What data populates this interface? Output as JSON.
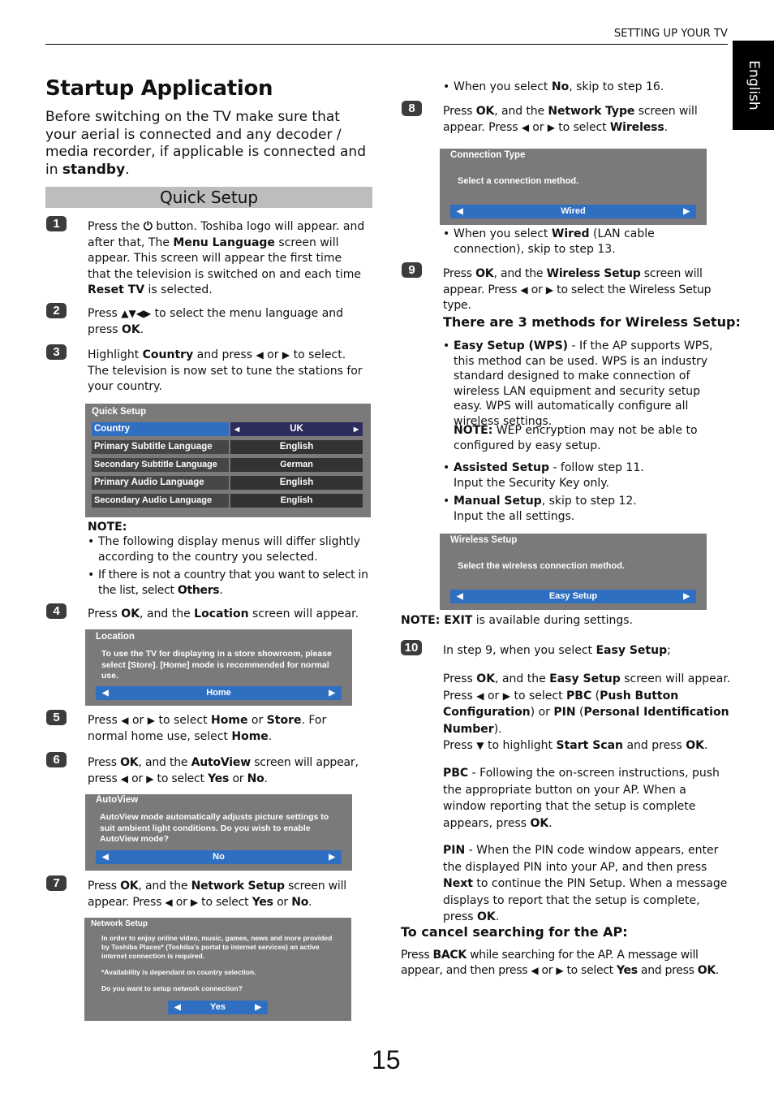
{
  "header": {
    "section": "SETTING UP YOUR TV",
    "language_tab": "English"
  },
  "title": "Startup Application",
  "intro": {
    "text": "Before switching on the TV make sure that your aerial is connected and any decoder / media recorder, if applicable is connected and in ",
    "bold": "standby",
    "end": "."
  },
  "quick_setup_heading": "Quick Setup",
  "steps": {
    "s1": {
      "num": "1",
      "a": "Press the ",
      "icon": "power-icon",
      "b": " button. Toshiba logo will appear. and after that, The ",
      "c": "Menu Language",
      "d": " screen will appear. This screen will appear the first time that the television is switched on and each time ",
      "e": "Reset TV",
      "f": " is selected."
    },
    "s2": {
      "num": "2",
      "a": "Press ",
      "arrows": "▲▼◀▶",
      "b": " to select the menu language and press ",
      "c": "OK",
      "d": "."
    },
    "s3": {
      "num": "3",
      "a": "Highlight ",
      "b": "Country",
      "c": " and press ",
      "d": " or ",
      "e": " to select. The television is now set to tune the stations for your country."
    },
    "s4": {
      "num": "4",
      "a": "Press ",
      "b": "OK",
      "c": ", and the ",
      "d": "Location",
      "e": " screen will appear."
    },
    "s5": {
      "num": "5",
      "a": "Press ",
      "b": " or ",
      "c": " to select ",
      "d": "Home",
      "e": " or ",
      "f": "Store",
      "g": ". For normal home use, select ",
      "h": "Home",
      "i": "."
    },
    "s6": {
      "num": "6",
      "a": "Press ",
      "b": "OK",
      "c": ", and the ",
      "d": "AutoView",
      "e": " screen will appear, press ",
      "f": " or ",
      "g": " to select ",
      "h": "Yes",
      "i": " or ",
      "j": "No",
      "k": "."
    },
    "s7": {
      "num": "7",
      "a": "Press ",
      "b": "OK",
      "c": ", and the ",
      "d": "Network Setup",
      "e": " screen will appear. Press ",
      "f": " or ",
      "g": " to select ",
      "h": "Yes",
      "i": " or ",
      "j": "No",
      "k": "."
    },
    "s8": {
      "num": "8",
      "a": "Press ",
      "b": "OK",
      "c": ", and the ",
      "d": "Network Type",
      "e": " screen will appear. Press ",
      "f": " or ",
      "g": " to select ",
      "h": "Wireless",
      "i": "."
    },
    "s9": {
      "num": "9",
      "a": "Press ",
      "b": "OK",
      "c": ", and the ",
      "d": "Wireless Setup",
      "e": " screen will appear. Press ",
      "f": " or ",
      "g": " to select the Wireless Setup type."
    },
    "s10": {
      "num": "10",
      "a": "In step 9, when you select ",
      "b": "Easy Setup",
      "c": ";"
    }
  },
  "left_arrow": "◀",
  "right_arrow": "▶",
  "down_arrow": "▼",
  "quick_setup_screen": {
    "title": "Quick Setup",
    "rows": [
      {
        "label": "Country",
        "value": "UK",
        "active": true
      },
      {
        "label": "Primary Subtitle Language",
        "value": "English"
      },
      {
        "label": "Secondary Subtitle Language",
        "value": "German"
      },
      {
        "label": "Primary Audio Language",
        "value": "English"
      },
      {
        "label": "Secondary Audio Language",
        "value": "English"
      }
    ]
  },
  "note1": {
    "label": "NOTE:",
    "b1": "The following display menus will differ slightly according to the country you selected.",
    "b2a": "If there is not a country that you want to select in the list, select ",
    "b2b": "Others",
    "b2c": "."
  },
  "location_screen": {
    "title": "Location",
    "message": "To use the TV for displaying in a store showroom, please select [Store].  [Home] mode is recommended for normal use.",
    "value": "Home"
  },
  "autoview_screen": {
    "title": "AutoView",
    "message": "AutoView mode automatically adjusts picture settings to suit ambient light conditions. Do you wish to enable AutoView mode?",
    "value": "No"
  },
  "network_setup_screen": {
    "title": "Network Setup",
    "message1": "In order to enjoy online video, music, games, news and more provided by Toshiba Places* (Toshiba's portal to internet services) an active internet connection is required.",
    "message2": "*Availability is dependant on country selection.",
    "message3": "Do you want to setup network connection?",
    "value": "Yes"
  },
  "right": {
    "bullet_no": {
      "a": "When you select ",
      "b": "No",
      "c": ", skip to step 16."
    },
    "connection_screen": {
      "title": "Connection Type",
      "message": "Select a connection method.",
      "value": "Wired"
    },
    "bullet_wired": {
      "a": "When you select ",
      "b": "Wired",
      "c": " (LAN cable connection), skip to step 13."
    },
    "methods_heading": "There are 3 methods for Wireless Setup:",
    "m1": {
      "b": "Easy Setup (WPS)",
      "t": " - If the AP supports WPS, this method can be used. WPS is an industry standard designed to make connection of wireless LAN equipment and security setup easy. WPS will automatically configure all wireless settings."
    },
    "wep_note": {
      "b": "NOTE:",
      "t": "  WEP encryption may not be able to configured by easy setup."
    },
    "m2": {
      "b": "Assisted Setup",
      "t": " -  follow step 11.",
      "t2": "Input the Security Key only."
    },
    "m3": {
      "b": "Manual Setup",
      "t": ", skip to step 12.",
      "t2": "Input the all settings."
    },
    "wireless_screen": {
      "title": "Wireless Setup",
      "message": "Select the wireless connection method.",
      "value": "Easy Setup"
    },
    "exit_note": {
      "b1": "NOTE:",
      "b2": " EXIT",
      "t": " is available during settings."
    },
    "easy": {
      "p1a": "Press ",
      "p1b": "OK",
      "p1c": ", and the ",
      "p1d": "Easy Setup",
      "p1e": " screen will appear.",
      "p2a": "Press ",
      "p2b": " or ",
      "p2c": " to select ",
      "p2d": "PBC",
      "p2e": " (",
      "p2f": "Push Button Configuration",
      "p2g": ") or ",
      "p2h": "PIN",
      "p2i": " (",
      "p2j": "Personal Identification Number",
      "p2k": ").",
      "p3a": "Press ",
      "p3b": " to highlight ",
      "p3c": "Start Scan",
      "p3d": " and press ",
      "p3e": "OK",
      "p3f": "."
    },
    "pbc": {
      "b": "PBC",
      "t": " - Following the on-screen instructions, push the appropriate button on your AP. When a window reporting that the setup is complete appears, press ",
      "ok": "OK",
      "end": "."
    },
    "pin": {
      "b": "PIN",
      "t": " - When the PIN code window appears, enter the displayed PIN into your AP, and then press ",
      "next": "Next",
      "t2": " to continue the PIN Setup. When a message displays to report that the setup is complete, press ",
      "ok": "OK",
      "end": "."
    },
    "cancel_heading": "To cancel searching for the AP:",
    "cancel": {
      "a": "Press ",
      "b": "BACK",
      "c": " while searching for the AP. A message will appear, and then press ",
      "d": " or ",
      "e": " to select ",
      "f": "Yes",
      "g": " and press ",
      "h": "OK",
      "i": "."
    }
  },
  "page_number": "15"
}
